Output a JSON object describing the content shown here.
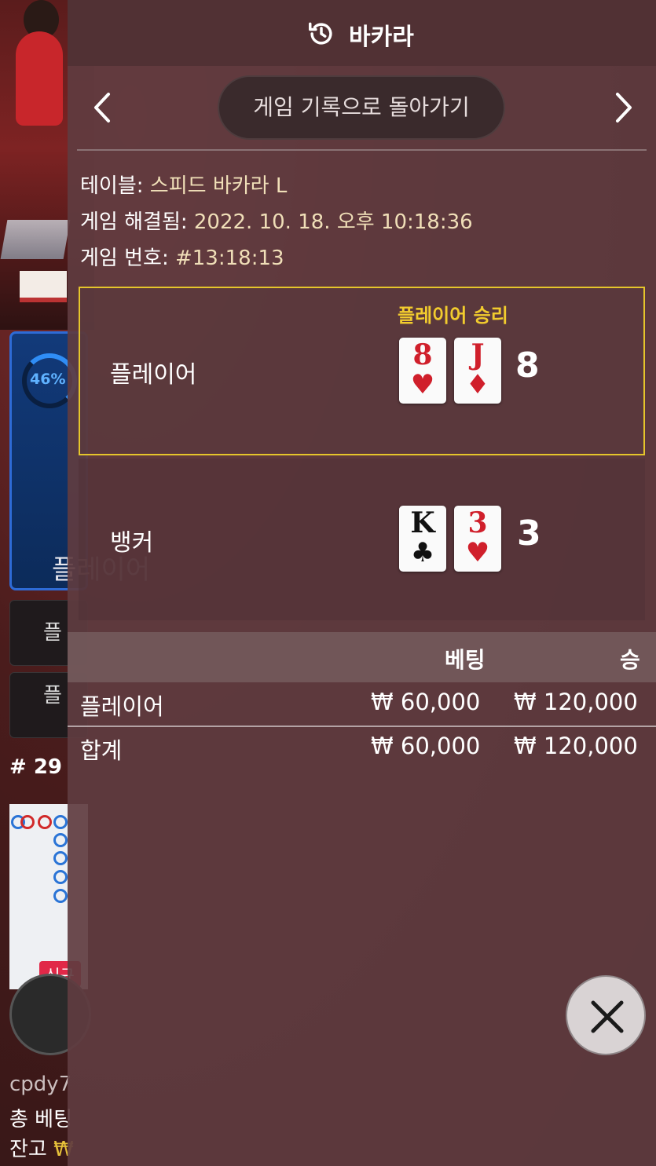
{
  "background": {
    "bet_progress": "46%",
    "player_spot_label": "플레이어",
    "round_number": "# 29",
    "new_badge": "신규",
    "username": "cpdy7",
    "total_bet_label": "총 베팅",
    "balance_label": "잔고",
    "balance_currency": "₩"
  },
  "panel": {
    "title": "바카라",
    "back_to_history_label": "게임 기록으로 돌아가기",
    "info": {
      "table_label": "테이블: ",
      "table_value": "스피드 바카라 L",
      "resolved_label": "게임 해결됨: ",
      "resolved_value": "2022. 10. 18. 오후 10:18:36",
      "game_number_label": "게임 번호: ",
      "game_number_value": "#13:18:13"
    },
    "result": {
      "win_label": "플레이어 승리",
      "player": {
        "label": "플레이어",
        "score": "8",
        "cards": [
          {
            "rank": "8",
            "suit": "♥",
            "color": "red"
          },
          {
            "rank": "J",
            "suit": "♦",
            "color": "red"
          }
        ]
      },
      "banker": {
        "label": "뱅커",
        "score": "3",
        "cards": [
          {
            "rank": "K",
            "suit": "♣",
            "color": "black"
          },
          {
            "rank": "3",
            "suit": "♥",
            "color": "red"
          }
        ]
      }
    },
    "bets_table": {
      "header_bet": "베팅",
      "header_win": "승",
      "rows": [
        {
          "label": "플레이어",
          "bet": "₩ 60,000",
          "win": "₩ 120,000"
        }
      ],
      "total": {
        "label": "합계",
        "bet": "₩ 60,000",
        "win": "₩ 120,000"
      }
    }
  },
  "colors": {
    "win_highlight": "#e5c52b",
    "card_red": "#d01f2b",
    "accent_blue": "#2f8df5"
  },
  "icons": [
    "history-icon",
    "chevron-left-icon",
    "chevron-right-icon",
    "close-icon"
  ]
}
